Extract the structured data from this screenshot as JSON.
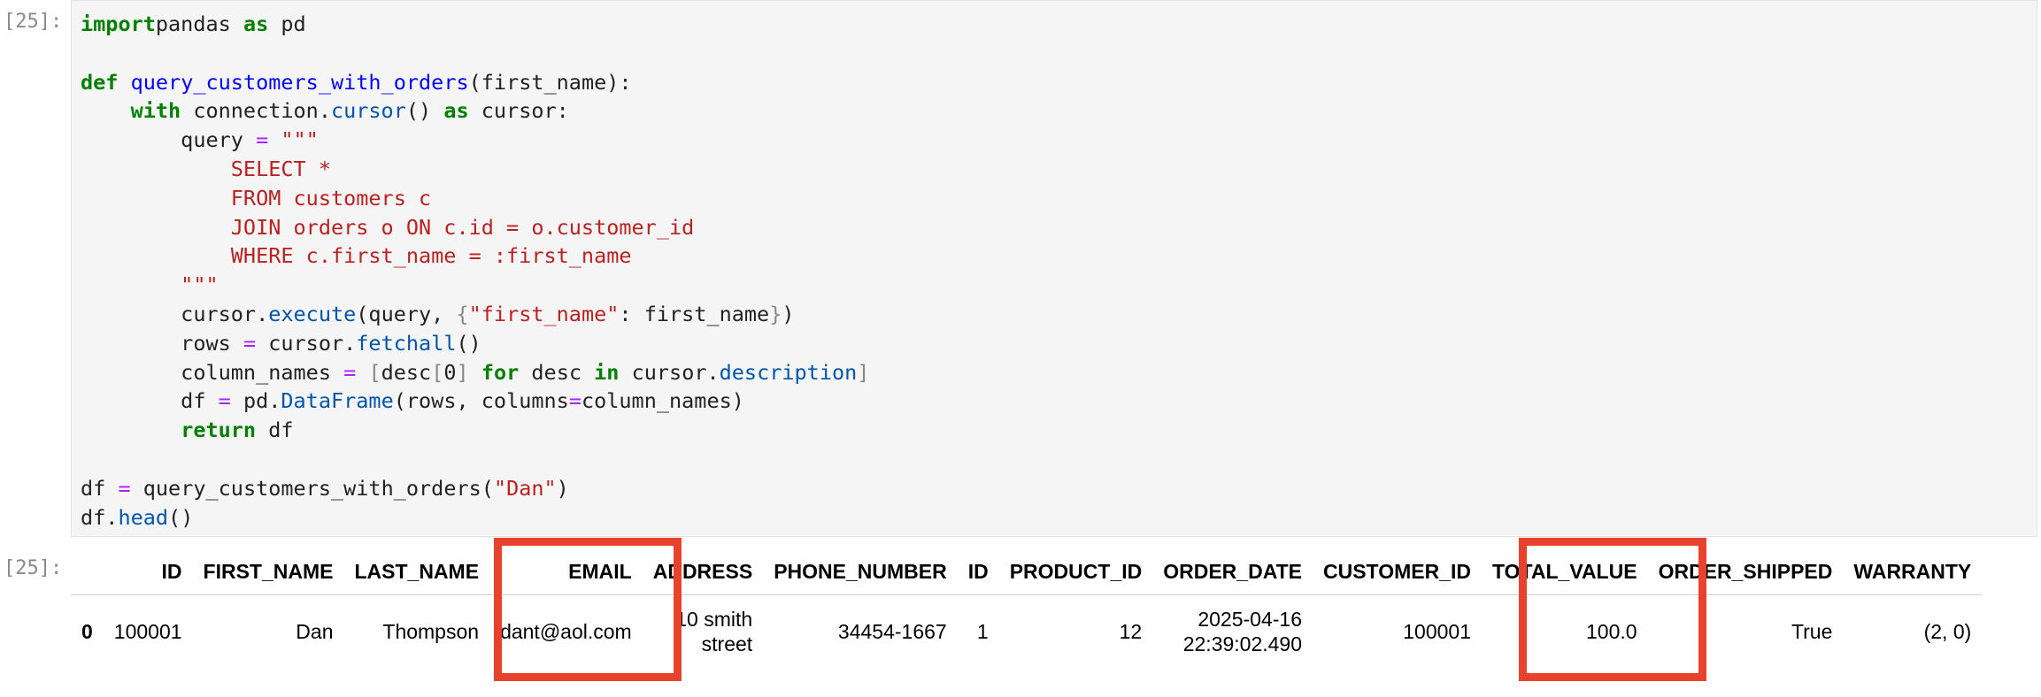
{
  "prompts": {
    "input": "[25]:",
    "output": "[25]:"
  },
  "code_lines": [
    [
      [
        "kw",
        "import"
      ],
      [
        "",
        "pandas "
      ],
      [
        "kw",
        "as"
      ],
      [
        "",
        " pd"
      ]
    ],
    [],
    [
      [
        "kw",
        "def"
      ],
      [
        "",
        " "
      ],
      [
        "fn",
        "query_customers_with_orders"
      ],
      [
        "",
        "(first_name):"
      ]
    ],
    [
      [
        "",
        "    "
      ],
      [
        "kw",
        "with"
      ],
      [
        "",
        " connection."
      ],
      [
        "attr",
        "cursor"
      ],
      [
        "",
        "() "
      ],
      [
        "kw",
        "as"
      ],
      [
        "",
        " cursor:"
      ]
    ],
    [
      [
        "",
        "        query "
      ],
      [
        "op",
        "="
      ],
      [
        "",
        " "
      ],
      [
        "str",
        "\"\"\""
      ]
    ],
    [
      [
        "str",
        "            SELECT *"
      ]
    ],
    [
      [
        "str",
        "            FROM customers c"
      ]
    ],
    [
      [
        "str",
        "            JOIN orders o ON c.id = o.customer_id"
      ]
    ],
    [
      [
        "str",
        "            WHERE c.first_name = :first_name"
      ]
    ],
    [
      [
        "str",
        "        \"\"\""
      ]
    ],
    [
      [
        "",
        "        cursor."
      ],
      [
        "attr",
        "execute"
      ],
      [
        "",
        "(query, "
      ],
      [
        "br",
        "{"
      ],
      [
        "str",
        "\"first_name\""
      ],
      [
        "",
        ": first_name"
      ],
      [
        "br",
        "}"
      ],
      [
        "",
        ")"
      ]
    ],
    [
      [
        "",
        "        rows "
      ],
      [
        "op",
        "="
      ],
      [
        "",
        " cursor."
      ],
      [
        "attr",
        "fetchall"
      ],
      [
        "",
        "()"
      ]
    ],
    [
      [
        "",
        "        column_names "
      ],
      [
        "op",
        "="
      ],
      [
        "",
        " "
      ],
      [
        "br",
        "["
      ],
      [
        "",
        "desc"
      ],
      [
        "br",
        "["
      ],
      [
        "",
        "0"
      ],
      [
        "br",
        "]"
      ],
      [
        "",
        " "
      ],
      [
        "kw",
        "for"
      ],
      [
        "",
        " desc "
      ],
      [
        "kw",
        "in"
      ],
      [
        "",
        " cursor."
      ],
      [
        "attr",
        "description"
      ],
      [
        "br",
        "]"
      ]
    ],
    [
      [
        "",
        "        df "
      ],
      [
        "op",
        "="
      ],
      [
        "",
        " pd."
      ],
      [
        "attr",
        "DataFrame"
      ],
      [
        "",
        "(rows, columns"
      ],
      [
        "op",
        "="
      ],
      [
        "",
        "column_names)"
      ]
    ],
    [
      [
        "",
        "        "
      ],
      [
        "kw",
        "return"
      ],
      [
        "",
        " df"
      ]
    ],
    [],
    [
      [
        "",
        "df "
      ],
      [
        "op",
        "="
      ],
      [
        "",
        " query_customers_with_orders("
      ],
      [
        "str",
        "\"Dan\""
      ],
      [
        "",
        ")"
      ]
    ],
    [
      [
        "",
        "df."
      ],
      [
        "attr",
        "head"
      ],
      [
        "",
        "()"
      ]
    ]
  ],
  "table": {
    "headers": [
      "",
      "ID",
      "FIRST_NAME",
      "LAST_NAME",
      "EMAIL",
      "ADDRESS",
      "PHONE_NUMBER",
      "ID",
      "PRODUCT_ID",
      "ORDER_DATE",
      "CUSTOMER_ID",
      "TOTAL_VALUE",
      "ORDER_SHIPPED",
      "WARRANTY"
    ],
    "rows": [
      [
        "0",
        "100001",
        "Dan",
        "Thompson",
        "dant@aol.com",
        "10 smith street",
        "34454-1667",
        "1",
        "12",
        "2025-04-16 22:39:02.490",
        "100001",
        "100.0",
        "True",
        "(2, 0)"
      ]
    ]
  },
  "highlight_color": "#e8412c"
}
